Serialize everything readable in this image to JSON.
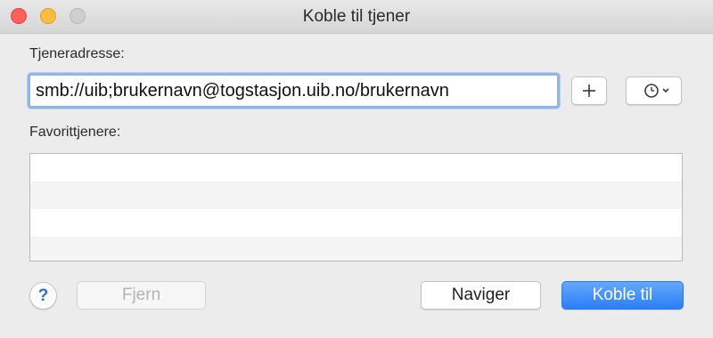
{
  "window": {
    "title": "Koble til tjener"
  },
  "server_address": {
    "label": "Tjeneradresse:",
    "value": "smb://uib;brukernavn@togstasjon.uib.no/brukernavn"
  },
  "favorites": {
    "label": "Favorittjenere:",
    "rows": [
      "",
      "",
      "",
      ""
    ]
  },
  "buttons": {
    "help": "?",
    "remove": "Fjern",
    "browse": "Naviger",
    "connect": "Koble til"
  },
  "icons": {
    "add": "plus-icon",
    "recent": "clock-icon",
    "dropdown": "chevron-down-icon"
  },
  "colors": {
    "accent": "#2a7ef6",
    "focus_ring": "#8fb6ea",
    "close": "#fc605c",
    "minimize": "#fdbc40"
  }
}
